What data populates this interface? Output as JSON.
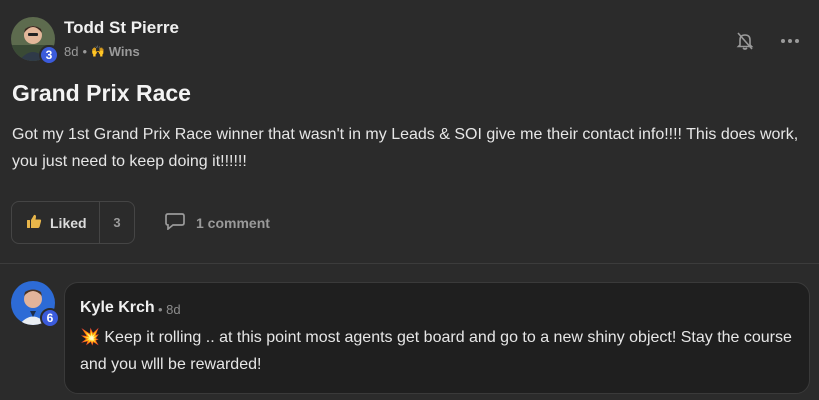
{
  "post": {
    "author": "Todd St Pierre",
    "author_level": "3",
    "time": "8d",
    "separator": "•",
    "category_emoji": "🙌",
    "category": "Wins",
    "title": "Grand Prix Race",
    "body": "Got my 1st Grand Prix Race winner that wasn't in my Leads & SOI give me their contact info!!!! This does work, you just need to keep doing it!!!!!!",
    "like_label": "Liked",
    "like_count": "3",
    "comment_label": "1 comment"
  },
  "comment": {
    "author": "Kyle Krch",
    "author_level": "6",
    "time": "• 8d",
    "emoji": "💥",
    "text": "Keep it rolling .. at this point most agents get board and go to a new shiny object! Stay the course and you wlll be rewarded!"
  },
  "colors": {
    "background": "#2b2b2b",
    "comment_bubble": "#1f1f1f",
    "level_badge": "#3b5bdb",
    "like_icon": "#e8b64a"
  }
}
